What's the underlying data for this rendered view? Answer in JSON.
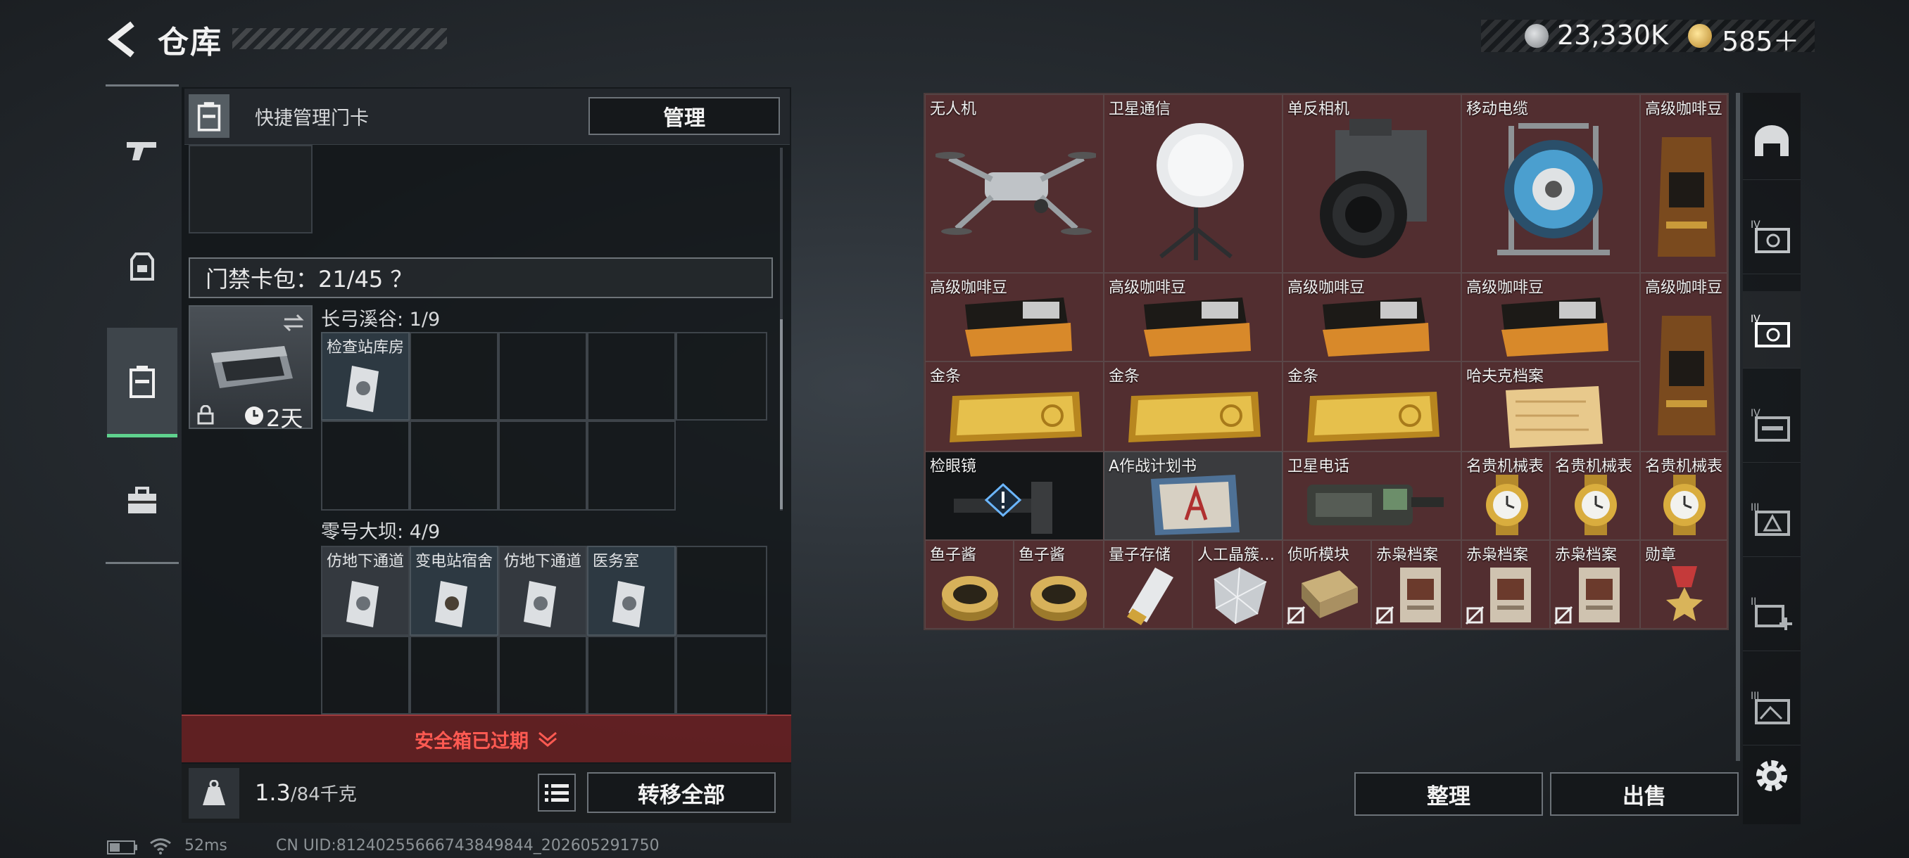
{
  "header": {
    "title": "仓库",
    "currency": {
      "silver": "23,330K",
      "gold": "585＋"
    }
  },
  "card_panel": {
    "quick_manage_label": "快捷管理门卡",
    "manage_button": "管理",
    "keycard_pack_label": "门禁卡包：21/45 ？",
    "card_timer": "2天",
    "sections": [
      {
        "title": "长弓溪谷: 1/9",
        "cards": [
          "检查站库房"
        ]
      },
      {
        "title": "零号大坝: 4/9",
        "cards": [
          "仿地下通道",
          "变电站宿舍",
          "仿地下通道",
          "医务室"
        ]
      }
    ],
    "expired_warning": "安全箱已过期",
    "weight_value": "1.3",
    "weight_capacity": "/84千克",
    "move_all_button": "转移全部"
  },
  "status_bar": {
    "ping": "52ms",
    "uid": "CN UID:8124025566674384984​4_202605291750"
  },
  "inventory": {
    "items": [
      {
        "label": "无人机",
        "style": "red"
      },
      {
        "label": "卫星通信",
        "style": "red"
      },
      {
        "label": "单反相机",
        "style": "red"
      },
      {
        "label": "移动电缆",
        "style": "red"
      },
      {
        "label": "高级咖啡豆",
        "style": "red"
      },
      {
        "label": "高级咖啡豆",
        "style": "red"
      },
      {
        "label": "高级咖啡豆",
        "style": "red"
      },
      {
        "label": "高级咖啡豆",
        "style": "red"
      },
      {
        "label": "高级咖啡豆",
        "style": "red"
      },
      {
        "label": "高级咖啡豆",
        "style": "red"
      },
      {
        "label": "金条",
        "style": "red"
      },
      {
        "label": "金条",
        "style": "red"
      },
      {
        "label": "金条",
        "style": "red"
      },
      {
        "label": "哈夫克档案",
        "style": "red"
      },
      {
        "label": "检眼镜",
        "style": "dark"
      },
      {
        "label": "A作战计划书",
        "style": "gray"
      },
      {
        "label": "卫星电话",
        "style": "red"
      },
      {
        "label": "名贵机械表",
        "style": "red"
      },
      {
        "label": "名贵机械表",
        "style": "red"
      },
      {
        "label": "名贵机械表",
        "style": "red"
      },
      {
        "label": "鱼子酱",
        "style": "red"
      },
      {
        "label": "鱼子酱",
        "style": "red"
      },
      {
        "label": "量子存储",
        "style": "red"
      },
      {
        "label": "人工晶簇…",
        "style": "red"
      },
      {
        "label": "侦听模块",
        "style": "red"
      },
      {
        "label": "赤枭档案",
        "style": "red"
      },
      {
        "label": "赤枭档案",
        "style": "red"
      },
      {
        "label": "赤枭档案",
        "style": "red"
      },
      {
        "label": "勋章",
        "style": "red"
      }
    ],
    "sort_button": "整理",
    "sell_button": "出售"
  },
  "colors": {
    "accent_green": "#5fd28e",
    "warning_red": "#ff5a52",
    "item_red": "#522e30"
  }
}
